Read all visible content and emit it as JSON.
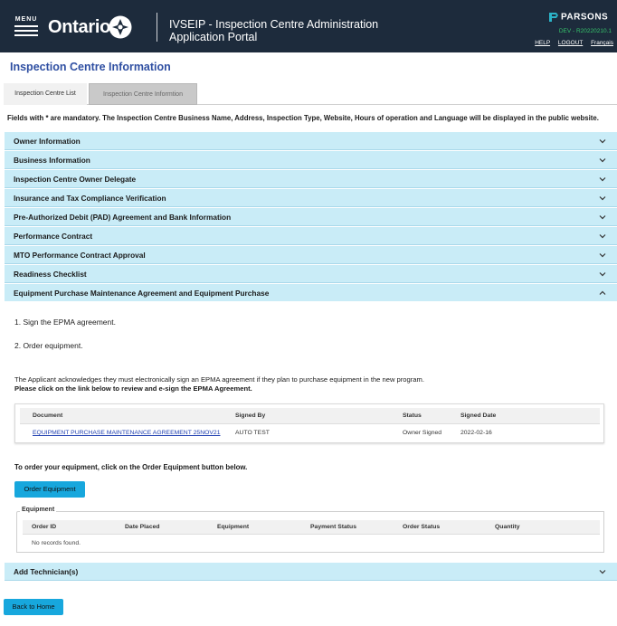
{
  "header": {
    "menu_label": "MENU",
    "brand": "Ontario",
    "app_title_line1": "IVSEIP -  Inspection Centre Administration",
    "app_title_line2": "Application Portal",
    "company": "PARSONS",
    "environment": "DEV - R20220210.1",
    "links": {
      "help": "HELP",
      "logout": "LOGOUT",
      "language": "Français"
    },
    "colors": {
      "background": "#1d2b3c",
      "env_text": "#36c36b"
    }
  },
  "page": {
    "title": "Inspection Centre Information",
    "tabs": [
      {
        "label": "Inspection Centre List"
      },
      {
        "label": "Inspection Centre Informtion"
      }
    ],
    "mandatory_note": "Fields with * are mandatory. The Inspection Centre Business Name, Address, Inspection Type, Website, Hours of operation and Language will be displayed in the public website."
  },
  "accordion": {
    "sections": [
      {
        "label": "Owner Information",
        "expanded": false
      },
      {
        "label": "Business Information",
        "expanded": false
      },
      {
        "label": "Inspection Centre Owner Delegate",
        "expanded": false
      },
      {
        "label": "Insurance and Tax Compliance Verification",
        "expanded": false
      },
      {
        "label": "Pre-Authorized Debit (PAD) Agreement and Bank Information",
        "expanded": false
      },
      {
        "label": "Performance Contract",
        "expanded": false
      },
      {
        "label": "MTO Performance Contract Approval",
        "expanded": false
      },
      {
        "label": "Readiness Checklist",
        "expanded": false
      },
      {
        "label": "Equipment Purchase Maintenance Agreement and Equipment Purchase",
        "expanded": true
      },
      {
        "label": "Add Technician(s)",
        "expanded": false
      }
    ],
    "accent": "#c9ecf7"
  },
  "epma": {
    "steps": [
      "1. Sign the EPMA agreement.",
      "2. Order equipment."
    ],
    "ack_text": "The Applicant acknowledges they must electronically sign an EPMA agreement if they plan to purchase equipment in the new program.",
    "review_text": "Please click on the link below to review and e-sign the EPMA Agreement.",
    "document_table": {
      "columns": [
        "Document",
        "Signed By",
        "Status",
        "Signed Date"
      ],
      "rows": [
        {
          "document": "EQUIPMENT PURCHASE MAINTENANCE AGREEMENT 25NOV21",
          "signed_by": "AUTO TEST",
          "status": "Owner Signed",
          "signed_date": "2022-02-16"
        }
      ]
    },
    "order_text": "To order your equipment, click on the Order Equipment button below.",
    "order_button": "Order Equipment",
    "equipment": {
      "legend": "Equipment",
      "columns": [
        "Order ID",
        "Date Placed",
        "Equipment",
        "Payment Status",
        "Order Status",
        "Quantity"
      ],
      "empty_text": "No records found."
    }
  },
  "footer": {
    "back_button": "Back to Home",
    "button_color": "#17a7dd"
  }
}
